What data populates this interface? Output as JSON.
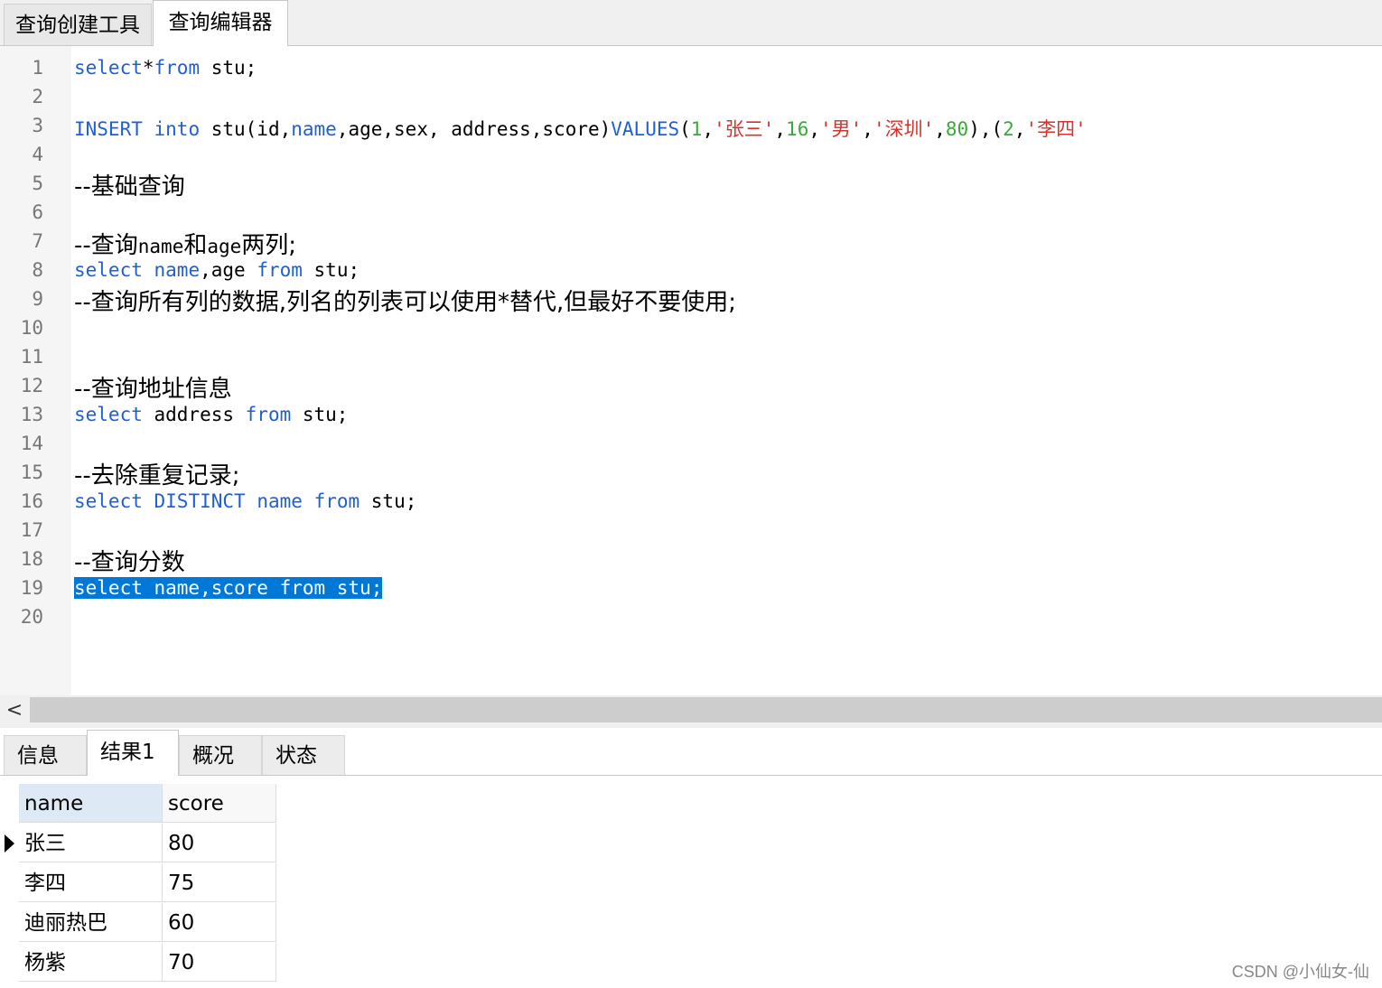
{
  "tabs": [
    "查询创建工具",
    "查询编辑器"
  ],
  "editor": {
    "line_numbers": [
      "1",
      "2",
      "3",
      "4",
      "5",
      "6",
      "7",
      "8",
      "9",
      "10",
      "11",
      "12",
      "13",
      "14",
      "15",
      "16",
      "17",
      "18",
      "19",
      "20"
    ],
    "line1": {
      "kw_select": "select",
      "star": "*",
      "kw_from": "from",
      "rest": " stu;"
    },
    "line3": {
      "kw_insert": "INSERT",
      "kw_into": "into",
      "p1": " stu(id,",
      "kw_name": "name",
      "p2": ",age,sex, address,score)",
      "kw_values": "VALUES",
      "p3": "(",
      "n1": "1",
      "s1": "'张三'",
      "n2": "16",
      "s2": "'男'",
      "s3": "'深圳'",
      "n3": "80",
      "p4": "),(",
      "n4": "2",
      "s4": "'李四'"
    },
    "line5": "--基础查询",
    "line7": {
      "c1": "--查询",
      "t1": "name",
      "c2": "和",
      "t2": "age",
      "c3": "两列;"
    },
    "line8": {
      "kw_select": "select",
      "kw_name": "name",
      "p1": ",age ",
      "kw_from": "from",
      "rest": " stu;"
    },
    "line9": "--查询所有列的数据,列名的列表可以使用*替代,但最好不要使用;",
    "line12": "--查询地址信息",
    "line13": {
      "kw_select": "select",
      "mid": " address ",
      "kw_from": "from",
      "rest": " stu;"
    },
    "line15": "--去除重复记录;",
    "line16": {
      "kw_select": "select",
      "kw_distinct": "DISTINCT",
      "kw_name": "name",
      "kw_from": "from",
      "rest": " stu;"
    },
    "line18": "--查询分数",
    "line19_selected": "select name,score from stu;"
  },
  "scroll_left_glyph": "<",
  "result_tabs": [
    "信息",
    "结果1",
    "概况",
    "状态"
  ],
  "grid": {
    "columns": [
      "name",
      "score"
    ],
    "rows": [
      {
        "name": "张三",
        "score": "80"
      },
      {
        "name": "李四",
        "score": "75"
      },
      {
        "name": "迪丽热巴",
        "score": "60"
      },
      {
        "name": "杨紫",
        "score": "70"
      }
    ]
  },
  "watermark": "CSDN @小仙女-仙"
}
